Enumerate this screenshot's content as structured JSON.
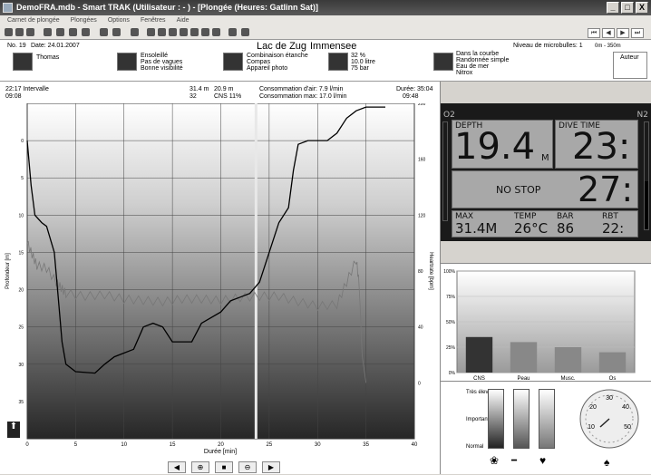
{
  "window": {
    "title": "DemoFRA.mdb - Smart TRAK (Utilisateur : - ) - [Plongée (Heures: Gatlinn Sat)]",
    "minimize": "_",
    "maximize": "□",
    "close": "X"
  },
  "menu": [
    "Carnet de plongée",
    "Plongées",
    "Options",
    "Fenêtres",
    "Aide"
  ],
  "nav": {
    "first": "⏮",
    "prev": "◀",
    "next": "▶",
    "last": "⏭"
  },
  "dive": {
    "number": "No. 19",
    "date": "Date: 24.01.2007",
    "location": "Lac de Zug",
    "site": "Immensee",
    "bubble_level": "Niveau de microbulles: 1",
    "altitude": "0m - 350m",
    "author": "Auteur"
  },
  "info_blocks": {
    "buddy": "Thomas",
    "conditions": [
      "Ensoleillé",
      "Pas de vagues",
      "Bonne visibilité"
    ],
    "equipment": [
      "Combinaison étanche",
      "Compas",
      "Appareil photo"
    ],
    "gas": [
      "32 %",
      "10.0 litre",
      "75 bar"
    ],
    "activity": [
      "Dans la courbe",
      "Randonnée simple",
      "Eau de mer",
      "Nitrox"
    ]
  },
  "stats": {
    "interval": "22:17 Intervalle",
    "start": "09:08",
    "max_depth": "31.4 m",
    "avg_depth": "20.9 m",
    "temp": "32",
    "cns": "CNS  11%",
    "consumption_air": "Consommation d'air: 7.9 l/min",
    "consumption_max": "Consommation max: 17.0 l/min",
    "dive_time": "Durée: 35:04",
    "end": "09:48"
  },
  "chart_data": {
    "type": "line",
    "xlabel": "Durée [min]",
    "ylabel_left": "Profondeur [m]",
    "ylabel_right": "Heartrate [bpm]",
    "x_ticks": [
      "0",
      "5",
      "10",
      "15",
      "20",
      "25",
      "30",
      "35",
      "40"
    ],
    "y_left_ticks": [
      "0",
      "5",
      "10",
      "15",
      "20",
      "25",
      "30",
      "35"
    ],
    "y_right_ticks": [
      "200",
      "160",
      "120",
      "80",
      "40",
      "0"
    ],
    "xlim": [
      0,
      40
    ],
    "ylim_left": [
      -5,
      40
    ],
    "ylim_right": [
      -40,
      200
    ],
    "grid": true,
    "series": [
      {
        "name": "Profondeur",
        "axis": "left",
        "points": [
          [
            0,
            0
          ],
          [
            0.4,
            6
          ],
          [
            0.8,
            10
          ],
          [
            1.5,
            11
          ],
          [
            2,
            11.5
          ],
          [
            2.8,
            15
          ],
          [
            3.2,
            21
          ],
          [
            3.6,
            27
          ],
          [
            4,
            30
          ],
          [
            5,
            31
          ],
          [
            7,
            31.2
          ],
          [
            8,
            30
          ],
          [
            9,
            29
          ],
          [
            11,
            28
          ],
          [
            12,
            25
          ],
          [
            13,
            24.5
          ],
          [
            14,
            25
          ],
          [
            15,
            27
          ],
          [
            16,
            27
          ],
          [
            17,
            27
          ],
          [
            18,
            24.5
          ],
          [
            20,
            23
          ],
          [
            21,
            21.5
          ],
          [
            22,
            21
          ],
          [
            23,
            20.5
          ],
          [
            24,
            19
          ],
          [
            25,
            15
          ],
          [
            26,
            11
          ],
          [
            27,
            9
          ],
          [
            27.5,
            4
          ],
          [
            28,
            0.5
          ],
          [
            29,
            0
          ],
          [
            30,
            0
          ],
          [
            31,
            0
          ],
          [
            32,
            -1
          ],
          [
            33,
            -3
          ],
          [
            34,
            -4
          ],
          [
            35,
            -4.5
          ],
          [
            36,
            -4.5
          ],
          [
            37,
            -4.5
          ]
        ]
      },
      {
        "name": "Heartrate",
        "axis": "right",
        "points": [
          [
            0,
            100
          ],
          [
            0.5,
            92
          ],
          [
            1,
            84
          ],
          [
            2,
            82
          ],
          [
            3,
            72
          ],
          [
            3.5,
            68
          ],
          [
            4,
            64
          ],
          [
            6,
            62
          ],
          [
            8,
            63
          ],
          [
            10,
            60
          ],
          [
            12,
            59
          ],
          [
            14,
            58
          ],
          [
            16,
            60
          ],
          [
            18,
            60
          ],
          [
            20,
            59
          ],
          [
            22,
            61
          ],
          [
            24,
            62
          ],
          [
            26,
            62
          ],
          [
            28,
            58
          ],
          [
            30,
            55
          ],
          [
            32,
            56
          ],
          [
            33,
            72
          ],
          [
            34,
            88
          ],
          [
            34.3,
            70
          ],
          [
            34.6,
            20
          ],
          [
            35,
            0
          ]
        ]
      }
    ],
    "marker_x": 23.5
  },
  "dive_computer": {
    "o2": "O2",
    "n2": "N2",
    "depth_label": "DEPTH",
    "depth_value": "19.4",
    "depth_unit": "M",
    "time_label": "DIVE TIME",
    "time_value": "23:",
    "deco": "NO STOP",
    "deco_time": "27:",
    "max_label": "MAX",
    "max_value": "31.4M",
    "temp_label": "TEMP",
    "temp_value": "26°C",
    "bar_label": "BAR",
    "bar_value": "86",
    "rbt_label": "RBT",
    "rbt_value": "22:"
  },
  "bar_chart": {
    "type": "bar",
    "categories": [
      "CNS",
      "Peau",
      "Musc.",
      "Os"
    ],
    "values": [
      35,
      30,
      25,
      20
    ],
    "ticks": [
      "100%",
      "75%",
      "50%",
      "25%",
      "0%"
    ]
  },
  "gauges": {
    "levels": [
      "Très élevé",
      "Important",
      "Normal"
    ],
    "dial": [
      "10",
      "20",
      "30",
      "40",
      "50"
    ]
  },
  "colors": {
    "accent": "#2f7fd0",
    "title": "#4a4a4a"
  }
}
